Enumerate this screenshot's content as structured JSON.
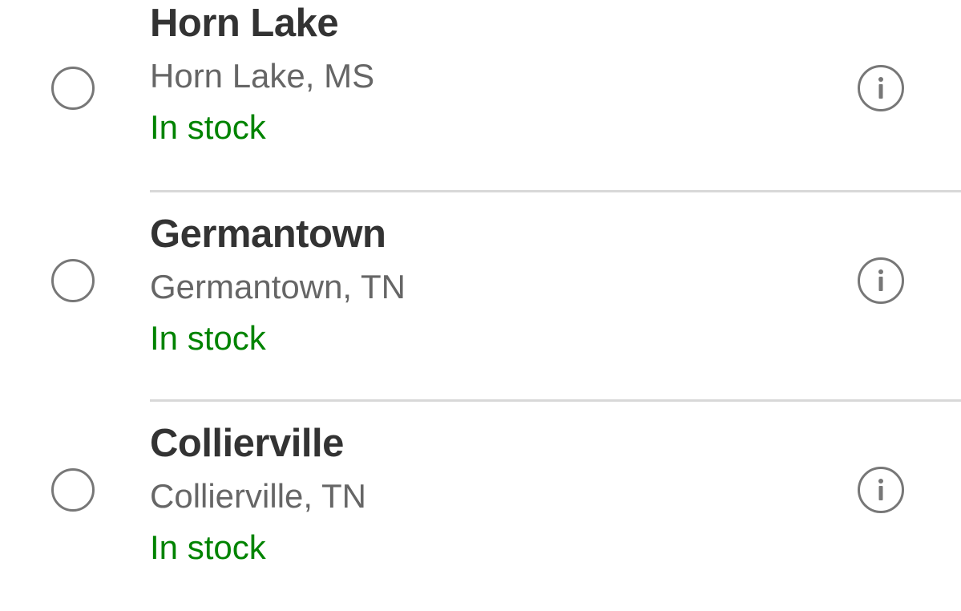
{
  "stores": [
    {
      "name": "Horn Lake",
      "address": "Horn Lake, MS",
      "status": "In stock"
    },
    {
      "name": "Germantown",
      "address": "Germantown, TN",
      "status": "In stock"
    },
    {
      "name": "Collierville",
      "address": "Collierville, TN",
      "status": "In stock"
    }
  ],
  "icons": {
    "radio": "radio-unselected-icon",
    "info": "info-icon"
  },
  "colors": {
    "name_text": "#333333",
    "address_text": "#666666",
    "in_stock": "#008300",
    "control_border": "#777777",
    "divider": "#d8d8d8"
  }
}
